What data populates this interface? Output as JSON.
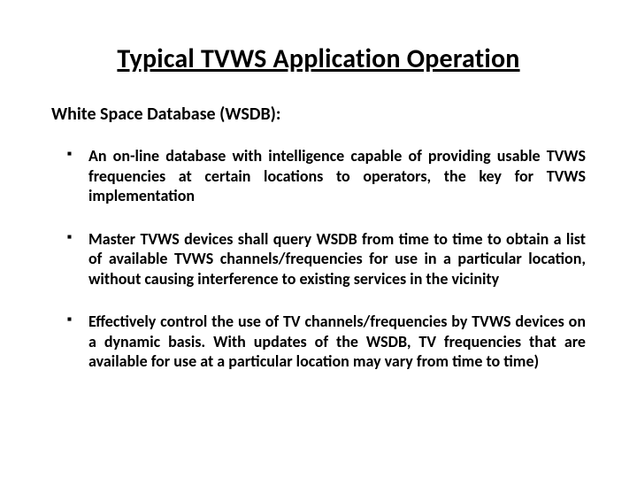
{
  "title": "Typical TVWS Application Operation",
  "subtitle": "White Space Database (WSDB):",
  "bullets": [
    "An on-line database with intelligence capable of providing usable TVWS frequencies at certain locations to operators, the key for TVWS implementation",
    "Master TVWS devices shall query WSDB from time to time to obtain a list of available TVWS channels/frequencies for use in a particular location, without causing interference to existing services in the vicinity",
    "Effectively control the use of TV channels/frequencies  by TVWS devices on a dynamic basis. With updates of the WSDB, TV frequencies that are available for use at a particular location may vary from time to time)"
  ]
}
